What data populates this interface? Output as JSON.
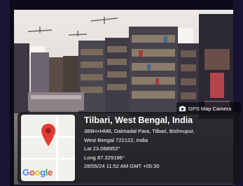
{
  "scene": {
    "description_colors": {
      "ceiling": "#e9e6e2",
      "shelf": "#4a4650",
      "floor": "#6f6a6c",
      "frame": "#1b1830"
    }
  },
  "badge": {
    "icon": "camera-icon",
    "label": "GPS Map Camera"
  },
  "map": {
    "icon": "location-pin-icon",
    "logo": "Google"
  },
  "location": {
    "title": "Tilbari, West Bengal, India",
    "address_line1": "389H+HM8, Dalmadal Para, Tilbari, Bishnupur,",
    "address_line2": "West Bengal 722122, India",
    "lat": "Lat 23.068952°",
    "long": "Long 87.329186°",
    "datetime": "28/05/24 11:52 AM GMT +05:30"
  }
}
